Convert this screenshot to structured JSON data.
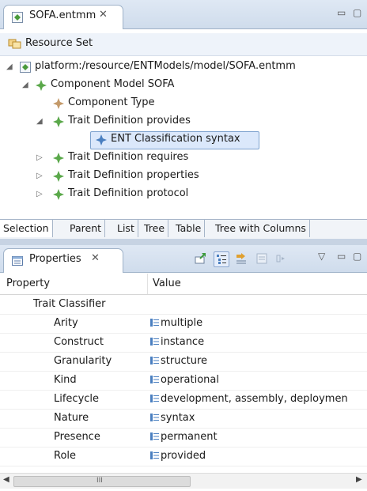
{
  "editor": {
    "tab_label": "SOFA.entmm",
    "tab_close": "✕",
    "minimize": "▭",
    "maximize": "▢",
    "resource_set": "Resource Set",
    "tree": [
      {
        "label": "platform:/resource/ENTModels/model/SOFA.entmm",
        "depth": 0,
        "twisty": "◢",
        "icon": "model-file-icon"
      },
      {
        "label": "Component Model SOFA",
        "depth": 1,
        "twisty": "◢",
        "icon": "green-diamond-icon"
      },
      {
        "label": "Component Type",
        "depth": 2,
        "twisty": "",
        "icon": "tan-diamond-icon"
      },
      {
        "label": "Trait Definition provides",
        "depth": 2,
        "twisty": "◢",
        "icon": "green-diamond-icon"
      },
      {
        "label": "ENT Classification syntax",
        "depth": 3,
        "twisty": "",
        "icon": "blue-diamond-icon",
        "selected": true
      },
      {
        "label": "Trait Definition requires",
        "depth": 2,
        "twisty": "▷",
        "icon": "green-diamond-icon"
      },
      {
        "label": "Trait Definition properties",
        "depth": 2,
        "twisty": "▷",
        "icon": "green-diamond-icon"
      },
      {
        "label": "Trait Definition protocol",
        "depth": 2,
        "twisty": "▷",
        "icon": "green-diamond-icon"
      }
    ],
    "bottom_tabs": [
      "Selection",
      "Parent",
      "List",
      "Tree",
      "Table",
      "Tree with Columns"
    ],
    "active_bottom_tab": "Selection"
  },
  "properties": {
    "tab_label": "Properties",
    "tab_close": "✕",
    "view_menu": "▽",
    "minimize": "▭",
    "maximize": "▢",
    "header": {
      "property": "Property",
      "value": "Value"
    },
    "group": "Trait Classifier",
    "rows": [
      {
        "name": "Arity",
        "value": "multiple"
      },
      {
        "name": "Construct",
        "value": "instance"
      },
      {
        "name": "Granularity",
        "value": "structure"
      },
      {
        "name": "Kind",
        "value": "operational"
      },
      {
        "name": "Lifecycle",
        "value": "development, assembly, deploymen"
      },
      {
        "name": "Nature",
        "value": "syntax"
      },
      {
        "name": "Presence",
        "value": "permanent"
      },
      {
        "name": "Role",
        "value": "provided"
      }
    ],
    "scroll_left": "◀",
    "scroll_right": "▶",
    "scroll_grip": "III"
  },
  "colors": {
    "accent": "#4a9a3a",
    "selection": "#dbe8fb",
    "chrome": "#cfdcec"
  }
}
